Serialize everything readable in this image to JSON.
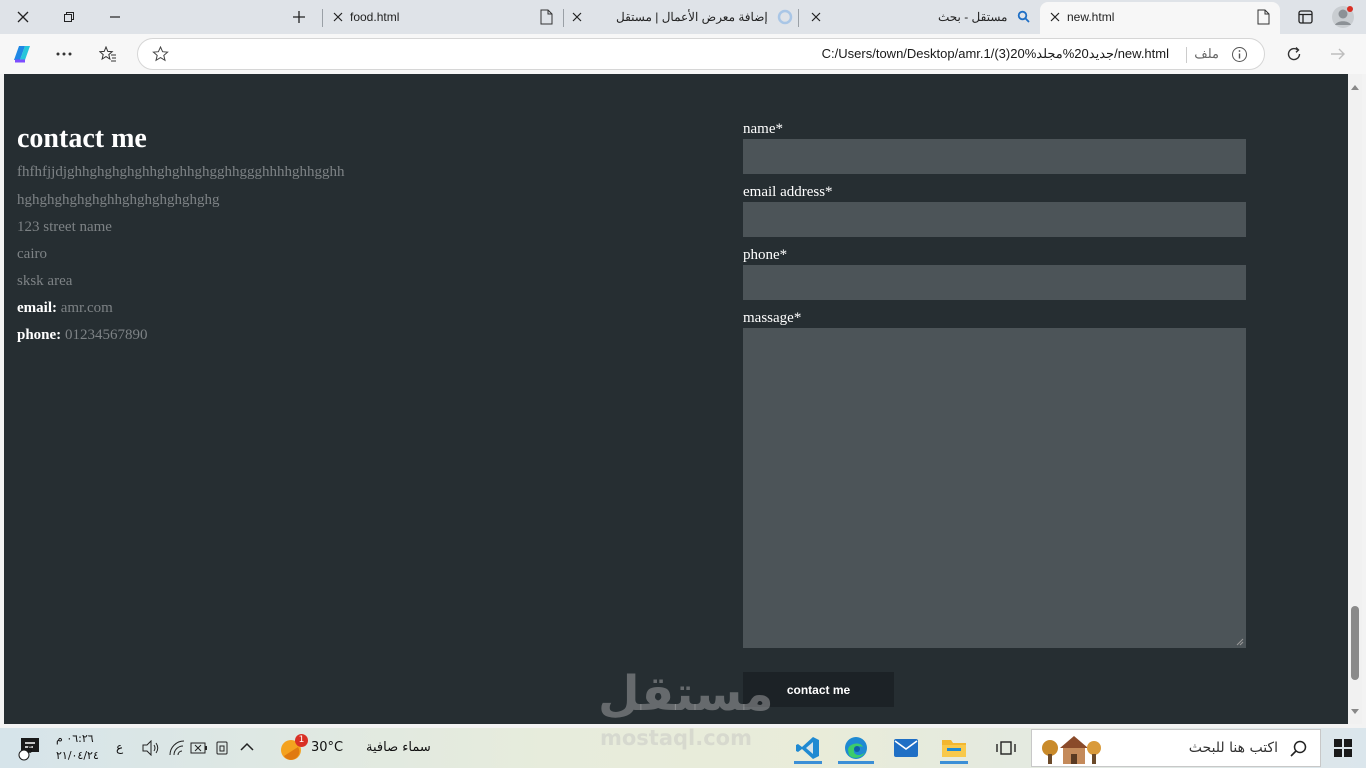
{
  "browser": {
    "tabs": [
      {
        "title": "new.html"
      },
      {
        "title": "مستقل - بحث"
      },
      {
        "title": "إضافة معرض الأعمال | مستقل"
      },
      {
        "title": "food.html"
      }
    ],
    "address": {
      "url": "C:/Users/town/Desktop/amr.1/(3)20%جديد20%مجلد/new.html",
      "scheme_label": "ملف"
    }
  },
  "page": {
    "heading": "contact me",
    "description_line1": "fhfhfjjdjghhghghghghhghghhghgghhggghhhhghhgghh",
    "description_line2": "hghghghghghghhghghghghghghg",
    "address_street": "123 street name",
    "address_city": "cairo",
    "address_area": "sksk area",
    "email_label": "email:",
    "email_value": "amr.com",
    "phone_label": "phone:",
    "phone_value": "01234567890",
    "form": {
      "name_label": "name*",
      "email_label": "email address*",
      "phone_label": "phone*",
      "message_label": "massage*",
      "submit_label": "contact me"
    }
  },
  "watermark": {
    "arabic": "مستقل",
    "latin": "mostaql.com"
  },
  "taskbar": {
    "search_placeholder": "اكتب هنا للبحث",
    "weather_text": "سماء صافية",
    "temperature": "30°C",
    "weather_badge": "1",
    "language": "ع",
    "time": "٠٦:٢٦ م",
    "date": "٢١/٠٤/٢٤",
    "notification_count": "5"
  },
  "colors": {
    "page_bg": "#262e32",
    "input_bg": "#4c5458",
    "button_bg": "#1c2226",
    "muted_text": "#7d8285"
  }
}
